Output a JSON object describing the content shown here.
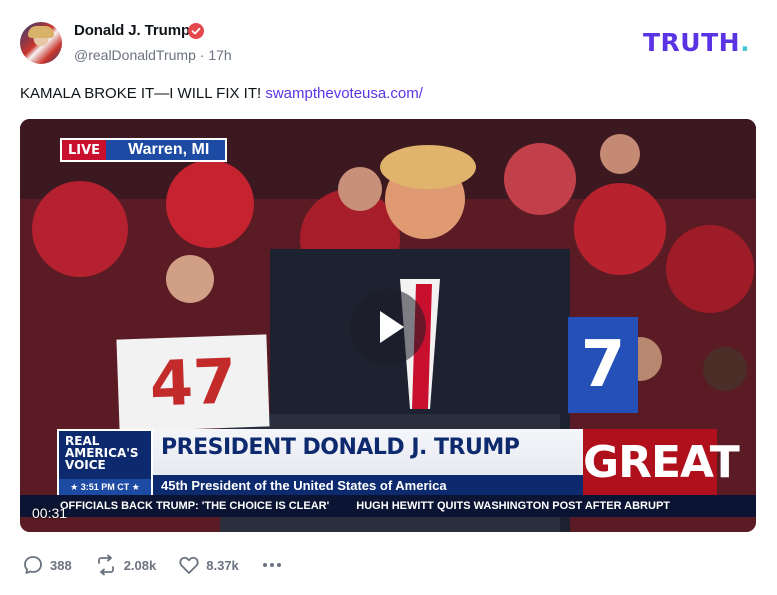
{
  "author": {
    "display_name": "Donald J. Trump",
    "handle": "@realDonaldTrump",
    "separator": "·",
    "time_ago": "17h"
  },
  "brand": {
    "logo_text": "TRUTH",
    "logo_dot": ".",
    "colors": {
      "primary": "#5a33e5",
      "dot": "#4cc9d8"
    }
  },
  "post": {
    "text": "KAMALA BROKE IT—I WILL FIX IT!",
    "link": "swampthevoteusa.com/"
  },
  "video": {
    "live_tag": "LIVE",
    "location": "Warren, MI",
    "sign_left": "47",
    "sign_right": "7",
    "network": "REAL AMERICA'S VOICE",
    "network_time": "★ 3:51 PM CT ★",
    "lower_third_name": "PRESIDENT DONALD J. TRUMP",
    "lower_third_sub": "45th President of the United States of America",
    "lower_third_tag": "GREAT",
    "ticker": [
      "OFFICIALS BACK TRUMP: 'THE CHOICE IS CLEAR'",
      "HUGH HEWITT QUITS WASHINGTON POST AFTER ABRUPT"
    ],
    "timestamp": "00:31"
  },
  "stats": {
    "replies": "388",
    "retruths": "2.08k",
    "likes": "8.37k"
  },
  "icons": [
    "verified-badge-icon",
    "play-icon",
    "reply-icon",
    "retruth-icon",
    "like-icon",
    "more-icon"
  ]
}
